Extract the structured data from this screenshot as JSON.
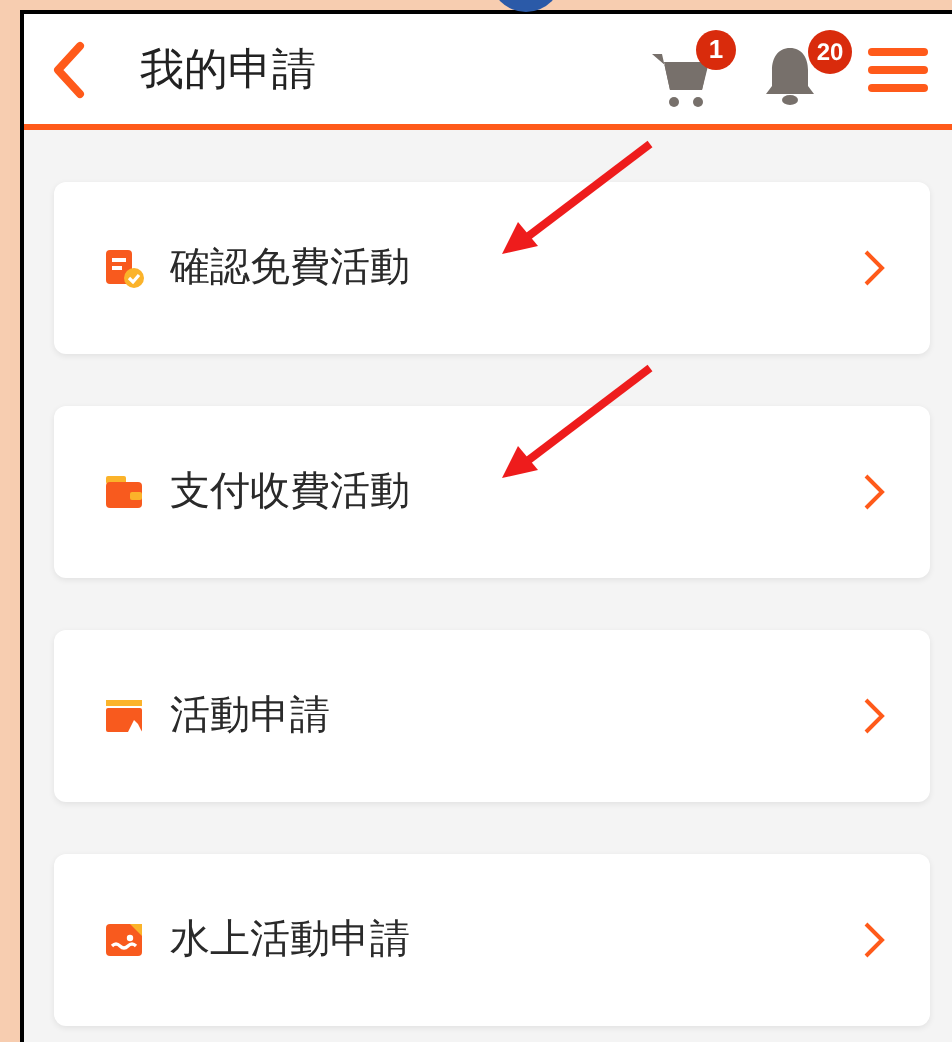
{
  "header": {
    "title": "我的申請",
    "cart_badge": "1",
    "bell_badge": "20"
  },
  "items": [
    {
      "label": "確認免費活動",
      "kind": "confirm",
      "annotated": true
    },
    {
      "label": "支付收費活動",
      "kind": "wallet",
      "annotated": true
    },
    {
      "label": "活動申請",
      "kind": "activity",
      "annotated": false
    },
    {
      "label": "水上活動申請",
      "kind": "water",
      "annotated": false
    }
  ]
}
